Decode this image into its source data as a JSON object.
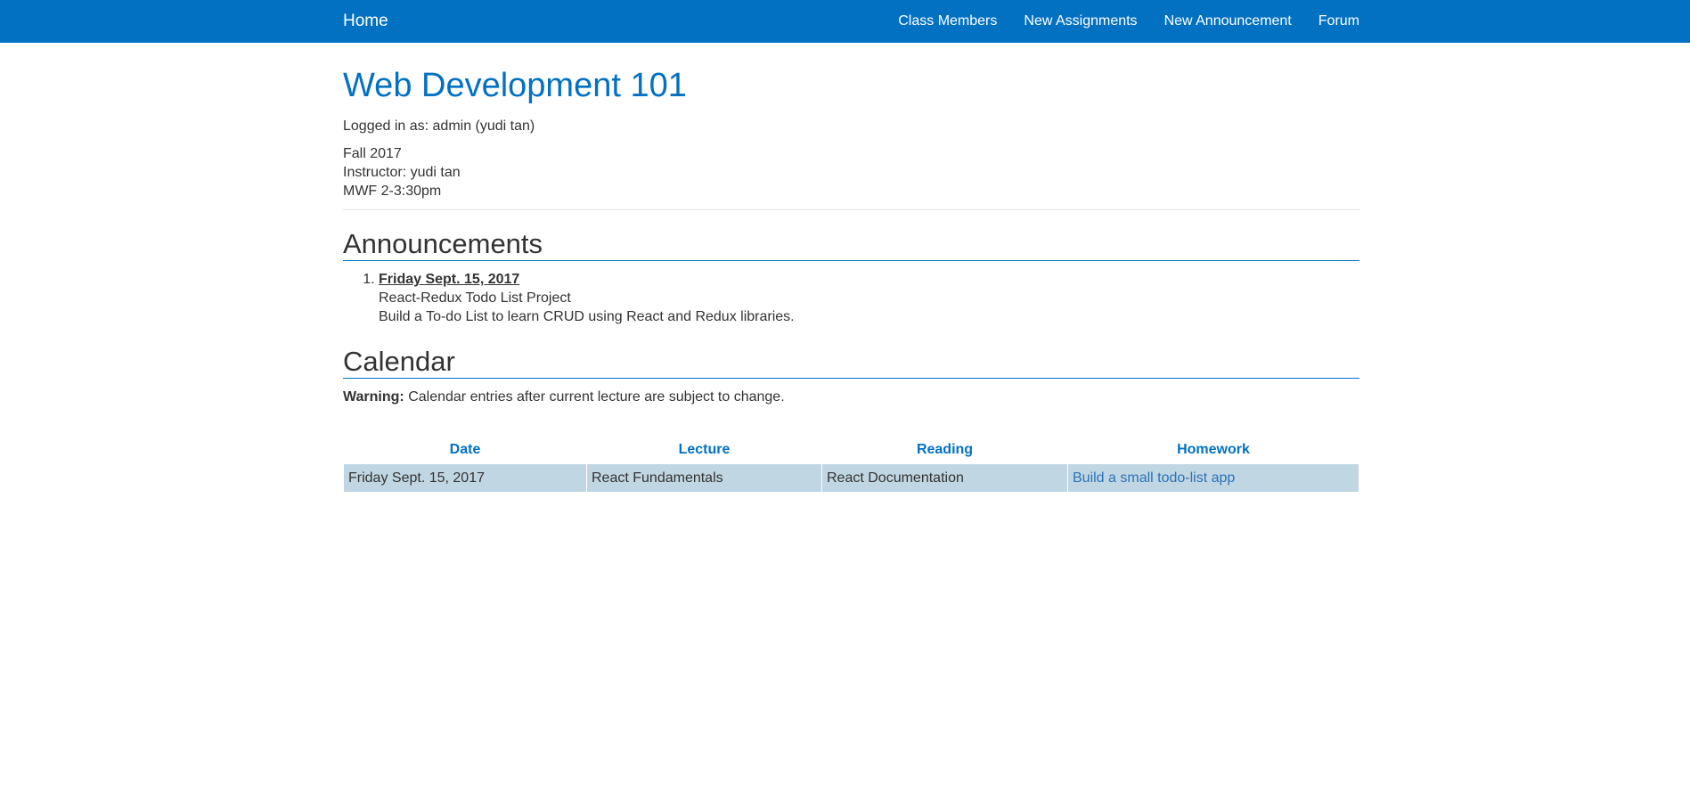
{
  "nav": {
    "brand": "Home",
    "links": [
      "Class Members",
      "New Assignments",
      "New Announcement",
      "Forum"
    ]
  },
  "course": {
    "title": "Web Development 101",
    "logged_in": "Logged in as: admin (yudi tan)",
    "term": "Fall 2017",
    "instructor": "Instructor: yudi tan",
    "schedule": "MWF 2-3:30pm"
  },
  "announcements": {
    "heading": "Announcements",
    "items": [
      {
        "number": "1.",
        "date": "Friday Sept. 15, 2017",
        "title": "React-Redux Todo List Project",
        "body": "Build a To-do List to learn CRUD using React and Redux libraries."
      }
    ]
  },
  "calendar": {
    "heading": "Calendar",
    "warning_label": "Warning:",
    "warning_text": "Calendar entries after current lecture are subject to change.",
    "columns": [
      "Date",
      "Lecture",
      "Reading",
      "Homework"
    ],
    "rows": [
      {
        "date": "Friday Sept. 15, 2017",
        "lecture": "React Fundamentals",
        "reading": "React Documentation",
        "homework": "Build a small todo-list app"
      }
    ]
  },
  "colors": {
    "primary": "#0271c2",
    "row_bg": "#c1d6e3",
    "link": "#2a73b8"
  }
}
